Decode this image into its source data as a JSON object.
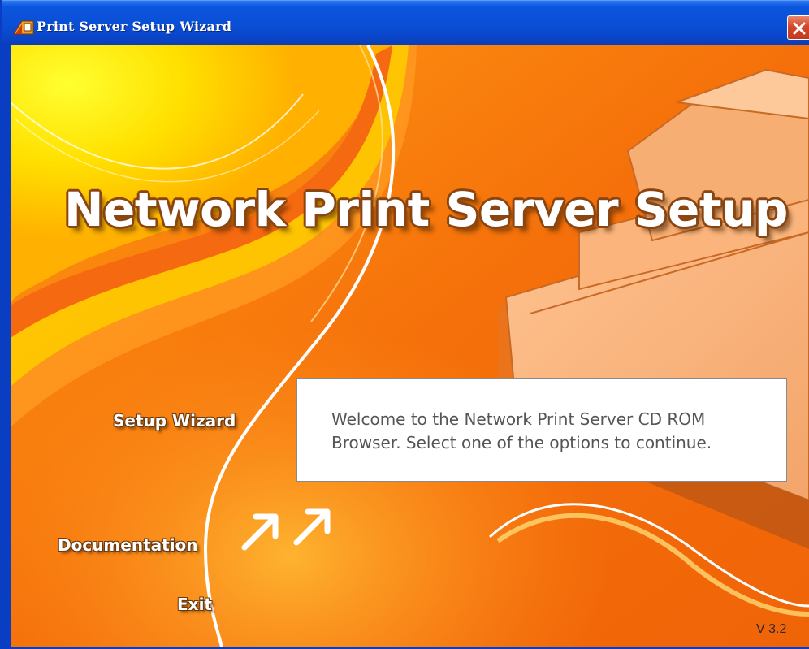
{
  "window": {
    "title": "Print Server Setup Wizard",
    "close_icon": "close-icon",
    "app_icon": "printer-app-icon"
  },
  "splash": {
    "headline": "Network Print Server Setup",
    "welcome_message": "Welcome to the Network Print Server CD ROM Browser. Select one of the options to continue.",
    "version": "V 3.2"
  },
  "menu": {
    "setup_wizard": "Setup Wizard",
    "documentation": "Documentation",
    "exit": "Exit"
  },
  "decor": {
    "arrows_icon": "double-arrow-up-right-icon"
  },
  "colors": {
    "titlebar_blue": "#0a4fd6",
    "close_red": "#d4472a",
    "splash_orange": "#f28010",
    "splash_yellow": "#ffe000"
  }
}
